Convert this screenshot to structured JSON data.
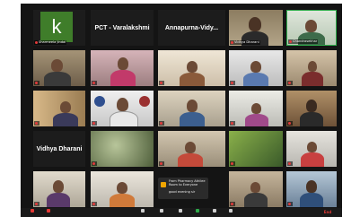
{
  "meeting": {
    "tiles": [
      {
        "name": "k",
        "type": "initial"
      },
      {
        "name": "PCT - Varalakshmi",
        "type": "name"
      },
      {
        "name": "Annapurna-Vidy...",
        "type": "name"
      },
      {
        "name": "",
        "type": "video"
      },
      {
        "name": "",
        "type": "video"
      },
      {
        "name": "Vidhya Dharani",
        "type": "name"
      }
    ],
    "labels": [
      "Sharmeela Jindal",
      "Vidhya Dharani",
      "Chandrasekhar",
      "",
      "",
      "",
      "",
      "",
      "",
      "",
      "",
      "",
      "",
      "",
      "",
      "",
      "",
      "",
      "",
      "",
      "",
      "",
      "",
      "",
      ""
    ]
  },
  "chat_notification": {
    "title": "From Pharmacy Athilee",
    "subtitle": "Room to Everyone",
    "message": "good evening sir"
  },
  "toolbar": {
    "items": [
      "Mute",
      "Start Video",
      "Security",
      "Participants",
      "Chat",
      "Share Screen",
      "Record",
      "Reactions"
    ],
    "participants_count": "37",
    "end_label": "End"
  },
  "colors": {
    "window_bg": "#141414",
    "share_green": "#2eaa4a",
    "end_red": "#e53935",
    "tile_k": "#3f7d2a"
  }
}
